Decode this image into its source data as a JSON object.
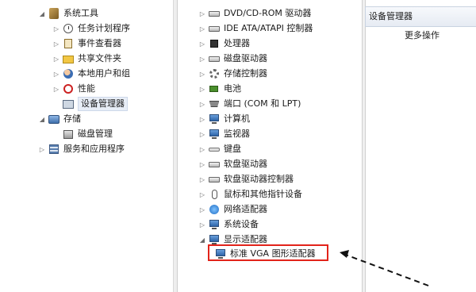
{
  "left_tree": [
    {
      "label": "系统工具",
      "expanded": true,
      "icon": "tools-icon"
    },
    {
      "label": "任务计划程序",
      "icon": "clock-icon"
    },
    {
      "label": "事件查看器",
      "icon": "event-viewer-icon"
    },
    {
      "label": "共享文件夹",
      "icon": "shared-folder-icon"
    },
    {
      "label": "本地用户和组",
      "icon": "users-icon"
    },
    {
      "label": "性能",
      "icon": "performance-icon"
    },
    {
      "label": "设备管理器",
      "icon": "device-manager-icon",
      "selected": true
    },
    {
      "label": "存储",
      "expanded": true,
      "icon": "storage-icon"
    },
    {
      "label": "磁盘管理",
      "icon": "disk-management-icon"
    },
    {
      "label": "服务和应用程序",
      "icon": "services-icon"
    }
  ],
  "device_tree": [
    {
      "label": "DVD/CD-ROM 驱动器",
      "icon": "dvd-drive-icon"
    },
    {
      "label": "IDE ATA/ATAPI 控制器",
      "icon": "ide-controller-icon"
    },
    {
      "label": "处理器",
      "icon": "processor-icon"
    },
    {
      "label": "磁盘驱动器",
      "icon": "disk-drive-icon"
    },
    {
      "label": "存储控制器",
      "icon": "storage-controller-icon"
    },
    {
      "label": "电池",
      "icon": "battery-icon"
    },
    {
      "label": "端口 (COM 和 LPT)",
      "icon": "port-icon"
    },
    {
      "label": "计算机",
      "icon": "computer-icon"
    },
    {
      "label": "监视器",
      "icon": "monitor-icon"
    },
    {
      "label": "键盘",
      "icon": "keyboard-icon"
    },
    {
      "label": "软盘驱动器",
      "icon": "floppy-drive-icon"
    },
    {
      "label": "软盘驱动器控制器",
      "icon": "floppy-controller-icon"
    },
    {
      "label": "鼠标和其他指针设备",
      "icon": "mouse-icon"
    },
    {
      "label": "网络适配器",
      "icon": "network-adapter-icon"
    },
    {
      "label": "系统设备",
      "icon": "system-device-icon"
    },
    {
      "label": "显示适配器",
      "icon": "display-adapter-icon",
      "expanded": true
    },
    {
      "label": "标准 VGA 图形适配器",
      "icon": "vga-adapter-icon",
      "child": true,
      "highlighted": true
    }
  ],
  "actions": {
    "title": "设备管理器",
    "more": "更多操作"
  },
  "colors": {
    "highlight": "#e2231a",
    "selection": "#e8eef7"
  }
}
